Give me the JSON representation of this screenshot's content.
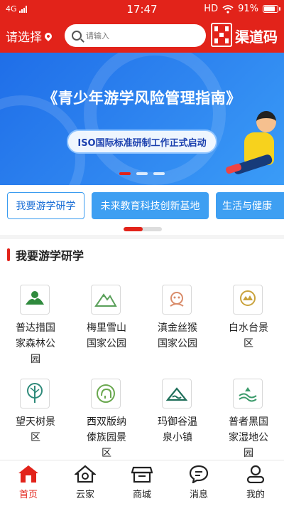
{
  "status_bar": {
    "network": "4G",
    "time": "17:47",
    "hd": "HD",
    "battery": "91%",
    "battery_level": 0.91
  },
  "header": {
    "location_label": "请选择",
    "search_placeholder": "请输入",
    "channel_code_label": "渠道码"
  },
  "banner": {
    "title": "《青少年游学风险管理指南》",
    "subtitle": "ISO国际标准研制工作正式启动",
    "pagination": {
      "count": 3,
      "active_index": 0
    }
  },
  "categories": [
    {
      "label": "我要游学研学",
      "selected": true
    },
    {
      "label": "未来教育科技创新基地",
      "selected": false
    },
    {
      "label": "生活与健康",
      "selected": false
    }
  ],
  "category_scroll_fraction": 0.5,
  "section": {
    "title": "我要游学研学",
    "items": [
      {
        "name": "普达措国家森林公园",
        "logo": "tree-hills-logo",
        "color": "#2f8a3d"
      },
      {
        "name": "梅里雪山国家公园",
        "logo": "snow-mountain-logo",
        "color": "#5aa05a"
      },
      {
        "name": "滇金丝猴国家公园",
        "logo": "monkey-logo",
        "color": "#d98c6a"
      },
      {
        "name": "白水台景区",
        "logo": "terrace-logo",
        "color": "#c9a23c"
      },
      {
        "name": "望天树景区",
        "logo": "tall-tree-logo",
        "color": "#2e8a7a"
      },
      {
        "name": "西双版纳傣族园景区",
        "logo": "elephant-logo",
        "color": "#6aa84f"
      },
      {
        "name": "玛御谷温泉小镇",
        "logo": "hot-spring-logo",
        "color": "#1f6f5a"
      },
      {
        "name": "普者黑国家湿地公园",
        "logo": "wetland-logo",
        "color": "#3a9a6a"
      }
    ]
  },
  "bottom_nav": [
    {
      "label": "首页",
      "icon": "home-icon",
      "active": true
    },
    {
      "label": "云家",
      "icon": "cloud-home-icon",
      "active": false
    },
    {
      "label": "商城",
      "icon": "store-icon",
      "active": false
    },
    {
      "label": "消息",
      "icon": "message-icon",
      "active": false
    },
    {
      "label": "我的",
      "icon": "profile-icon",
      "active": false
    }
  ],
  "colors": {
    "brand_red": "#e2231a",
    "banner_blue": "#2f86f0",
    "tab_blue": "#3e9ff2"
  }
}
